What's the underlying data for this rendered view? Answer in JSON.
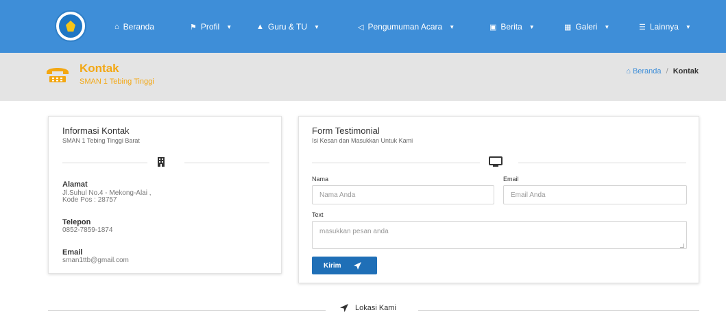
{
  "nav": {
    "items": [
      {
        "icon": "home-icon",
        "label": "Beranda",
        "dropdown": false
      },
      {
        "icon": "flag-icon",
        "label": "Profil",
        "dropdown": true
      },
      {
        "icon": "graduation-cap-icon",
        "label": "Guru & TU",
        "dropdown": true
      },
      {
        "icon": "bullhorn-icon",
        "label": "Pengumuman Acara",
        "dropdown": true
      },
      {
        "icon": "newspaper-icon",
        "label": "Berita",
        "dropdown": true
      },
      {
        "icon": "image-icon",
        "label": "Galeri",
        "dropdown": true
      },
      {
        "icon": "list-icon",
        "label": "Lainnya",
        "dropdown": true
      }
    ],
    "bg_color": "#3e8ed8"
  },
  "header": {
    "title": "Kontak",
    "subtitle": "SMAN 1 Tebing Tinggi",
    "accent_color": "#f3a712",
    "breadcrumb": {
      "home": "Beranda",
      "separator": "/",
      "current": "Kontak"
    }
  },
  "info": {
    "title": "Informasi Kontak",
    "subtitle": "SMAN 1 Tebing Tinggi Barat",
    "alamat_label": "Alamat",
    "alamat_line1": "Jl.Suhul No.4 - Mekong-Alai ,",
    "alamat_line2": "Kode Pos : 28757",
    "telepon_label": "Telepon",
    "telepon_value": "0852-7859-1874",
    "email_label": "Email",
    "email_value": "sman1ttb@gmail.com"
  },
  "form": {
    "title": "Form Testimonial",
    "subtitle": "Isi Kesan dan Masukkan Untuk Kami",
    "nama_label": "Nama",
    "nama_placeholder": "Nama Anda",
    "email_label": "Email",
    "email_placeholder": "Email Anda",
    "text_label": "Text",
    "text_placeholder": "masukkan pesan anda",
    "submit_label": "Kirim"
  },
  "location": {
    "label": "Lokasi Kami"
  }
}
